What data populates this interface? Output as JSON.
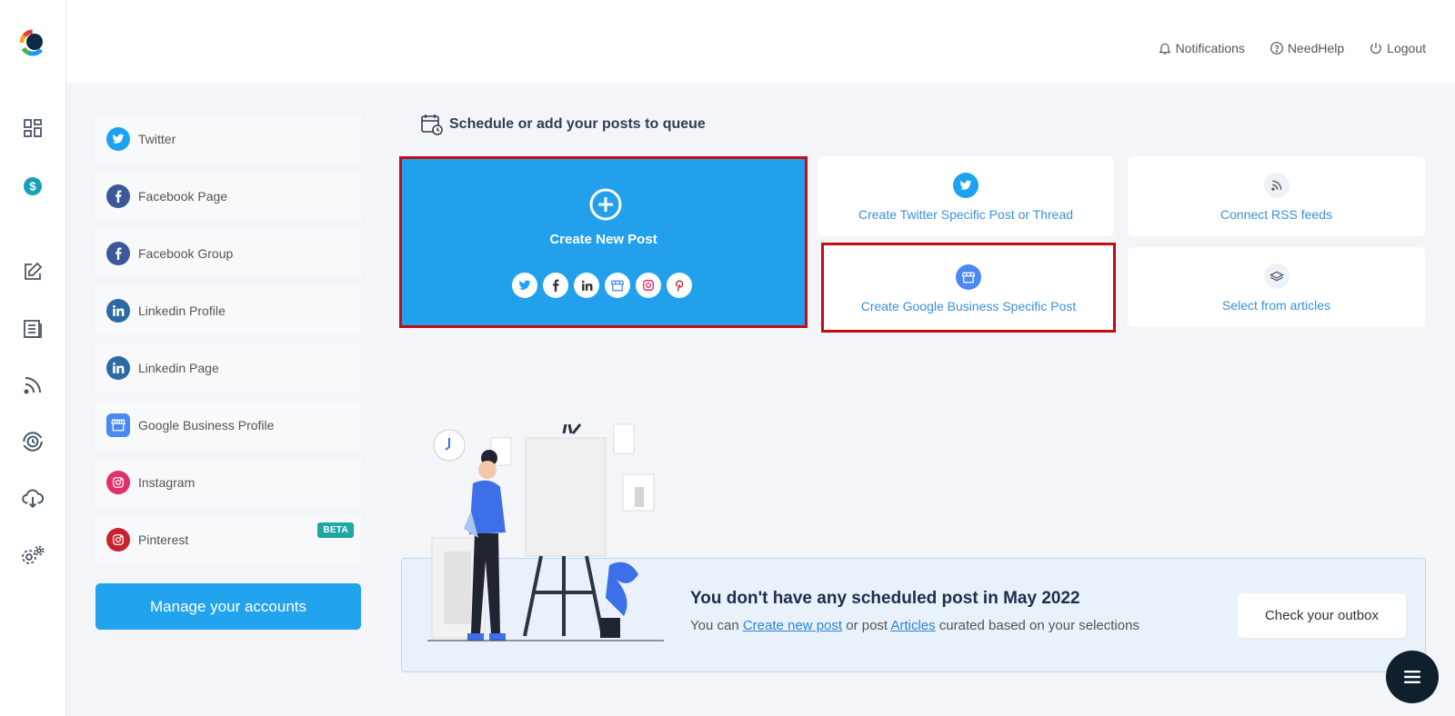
{
  "header": {
    "notifications": "Notifications",
    "need_help": "NeedHelp",
    "logout": "Logout"
  },
  "rail": {
    "items": [
      "dashboard-icon",
      "billing-icon",
      "compose-icon",
      "articles-icon",
      "rss-icon",
      "schedule-history-icon",
      "cloud-download-icon",
      "settings-icon"
    ]
  },
  "accounts": [
    {
      "label": "Twitter",
      "icon": "twitter-icon",
      "color": "#1da1f2"
    },
    {
      "label": "Facebook Page",
      "icon": "facebook-icon",
      "color": "#3b5998"
    },
    {
      "label": "Facebook Group",
      "icon": "facebook-icon",
      "color": "#3b5998"
    },
    {
      "label": "Linkedin Profile",
      "icon": "linkedin-icon",
      "color": "#2b6aa3"
    },
    {
      "label": "Linkedin Page",
      "icon": "linkedin-icon",
      "color": "#2b6aa3"
    },
    {
      "label": "Google Business Profile",
      "icon": "google-business-icon",
      "color": "#4a89f3"
    },
    {
      "label": "Instagram",
      "icon": "instagram-icon",
      "color": "#e1306c"
    },
    {
      "label": "Pinterest",
      "icon": "pinterest-icon",
      "color": "#c8232c",
      "badge": "BETA"
    }
  ],
  "manage_accounts": "Manage your accounts",
  "main": {
    "title": "Schedule or add your posts to queue",
    "create_new_post": "Create New Post",
    "cards": [
      {
        "label": "Create Twitter Specific Post or Thread",
        "icon": "twitter-icon"
      },
      {
        "label": "Connect RSS feeds",
        "icon": "rss-icon"
      },
      {
        "label": "Create Google Business Specific Post",
        "icon": "google-business-icon"
      },
      {
        "label": "Select from articles",
        "icon": "articles-icon"
      }
    ]
  },
  "empty_state": {
    "title": "You don't have any scheduled post in May 2022",
    "sub_prefix": "You can ",
    "link_create": "Create new post",
    "sub_middle": " or post ",
    "link_articles": "Articles",
    "sub_suffix": " curated based on your selections",
    "outbox_button": "Check your outbox"
  },
  "colors": {
    "primary": "#22a3ee",
    "highlight_border": "#c20e13",
    "link": "#3a90d8",
    "fab": "#0f1f2e"
  }
}
